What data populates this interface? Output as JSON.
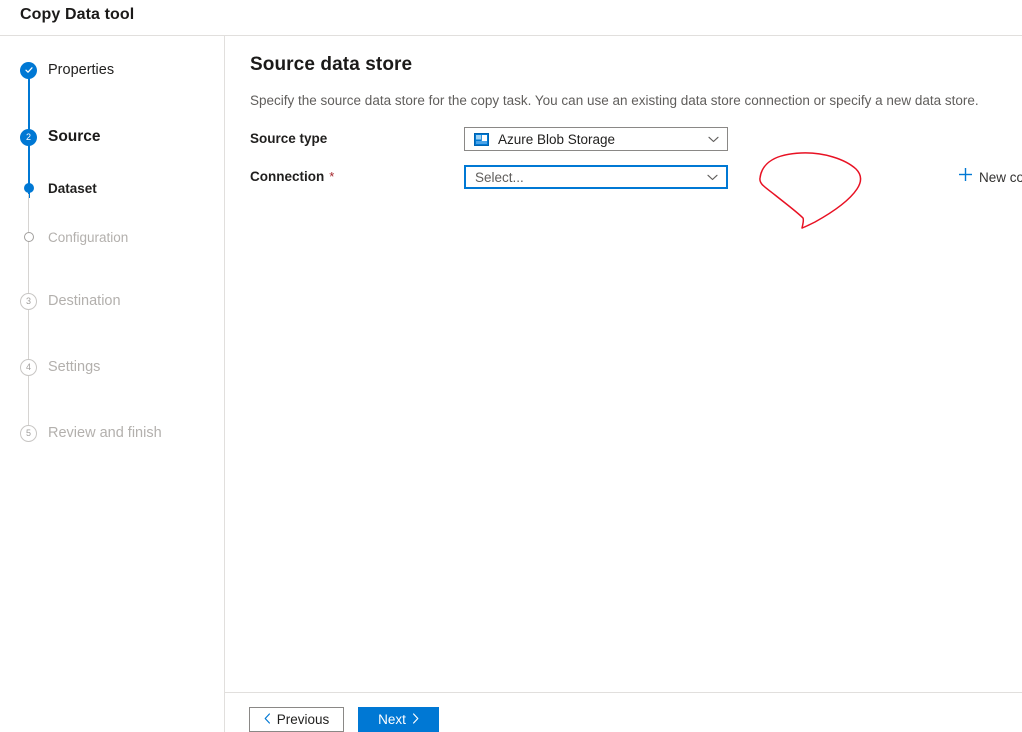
{
  "header": {
    "title": "Copy Data tool"
  },
  "sidebar": {
    "steps": [
      {
        "label": "Properties",
        "marker": "check",
        "state": "completed",
        "kind": "main"
      },
      {
        "label": "Source",
        "marker": "2",
        "state": "current",
        "kind": "main"
      },
      {
        "label": "Dataset",
        "marker": "dot",
        "state": "active",
        "kind": "sub"
      },
      {
        "label": "Configuration",
        "marker": "hollow",
        "state": "pending",
        "kind": "sub"
      },
      {
        "label": "Destination",
        "marker": "3",
        "state": "pending",
        "kind": "main"
      },
      {
        "label": "Settings",
        "marker": "4",
        "state": "pending",
        "kind": "main"
      },
      {
        "label": "Review and finish",
        "marker": "5",
        "state": "pending",
        "kind": "main"
      }
    ]
  },
  "main": {
    "title": "Source data store",
    "description": "Specify the source data store for the copy task. You can use an existing data store connection or specify a new data store.",
    "fields": {
      "source_type": {
        "label": "Source type",
        "value": "Azure Blob Storage",
        "icon": "azure-blob-storage-icon",
        "chevron": "chevron-down-icon"
      },
      "connection": {
        "label": "Connection",
        "required_marker": "*",
        "value": "",
        "placeholder": "Select...",
        "chevron": "chevron-down-icon",
        "focused": true
      }
    },
    "new_connection": {
      "label": "New connection",
      "icon": "plus-icon"
    },
    "annotation": {
      "type": "hand-drawn-circle",
      "color": "#e81123"
    }
  },
  "footer": {
    "previous": {
      "label": "Previous",
      "glyph": "chevron-left-icon"
    },
    "next": {
      "label": "Next",
      "glyph": "chevron-right-icon"
    }
  },
  "colors": {
    "accent": "#0078d4",
    "required": "#a4262c",
    "muted": "#b3b0ad",
    "annotation": "#e81123",
    "divider": "#e1dfdd"
  }
}
